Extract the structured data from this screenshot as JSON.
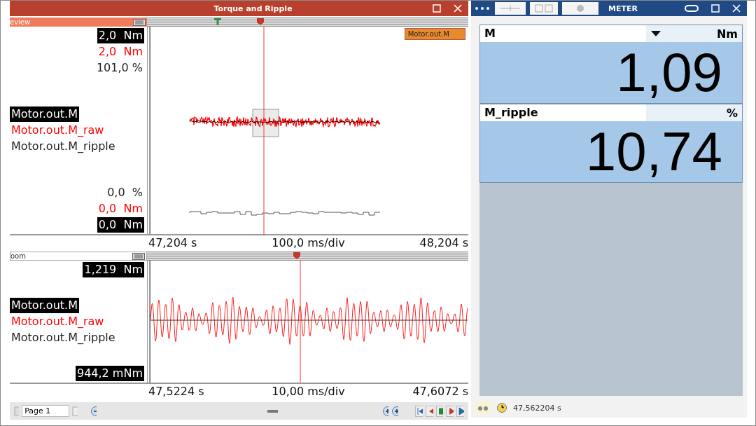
{
  "plot_window": {
    "title": "Torque and Ripple",
    "overview": {
      "header": "eview",
      "signal_tag": "Motor.out.M",
      "top_labels": [
        {
          "text": "2,0  Nm",
          "kind": "inverse"
        },
        {
          "text": "2,0  Nm",
          "kind": "red"
        },
        {
          "text": "101,0 %",
          "kind": "plain"
        }
      ],
      "legend": [
        {
          "text": "Motor.out.M",
          "kind": "inverse"
        },
        {
          "text": "Motor.out.M_raw",
          "kind": "red"
        },
        {
          "text": "Motor.out.M_ripple",
          "kind": "plain"
        }
      ],
      "bottom_labels": [
        {
          "text": "0,0  %",
          "kind": "plain"
        },
        {
          "text": "0,0  Nm",
          "kind": "red"
        },
        {
          "text": "0,0  Nm",
          "kind": "inverse"
        }
      ],
      "axis": [
        "47,204 s",
        "100,0 ms/div",
        "48,204 s"
      ]
    },
    "zoom": {
      "header": "oom",
      "top_labels": [
        {
          "text": "1,219  Nm",
          "kind": "inverse"
        }
      ],
      "legend": [
        {
          "text": "Motor.out.M",
          "kind": "inverse"
        },
        {
          "text": "Motor.out.M_raw",
          "kind": "red"
        },
        {
          "text": "Motor.out.M_ripple",
          "kind": "plain"
        }
      ],
      "bottom_labels": [
        {
          "text": "944,2 mNm",
          "kind": "inverse"
        }
      ],
      "axis": [
        "47,5224 s",
        "10,00 ms/div",
        "47,6072 s"
      ]
    },
    "toolbar": {
      "page": "Page 1"
    }
  },
  "meter_window": {
    "title": "METER",
    "rows": [
      {
        "name": "M",
        "unit": "Nm",
        "value": "1,09",
        "dropdown": true
      },
      {
        "name": "M_ripple",
        "unit": "%",
        "value": "10,74",
        "dropdown": false
      }
    ],
    "status_time": "47,562204 s"
  }
}
